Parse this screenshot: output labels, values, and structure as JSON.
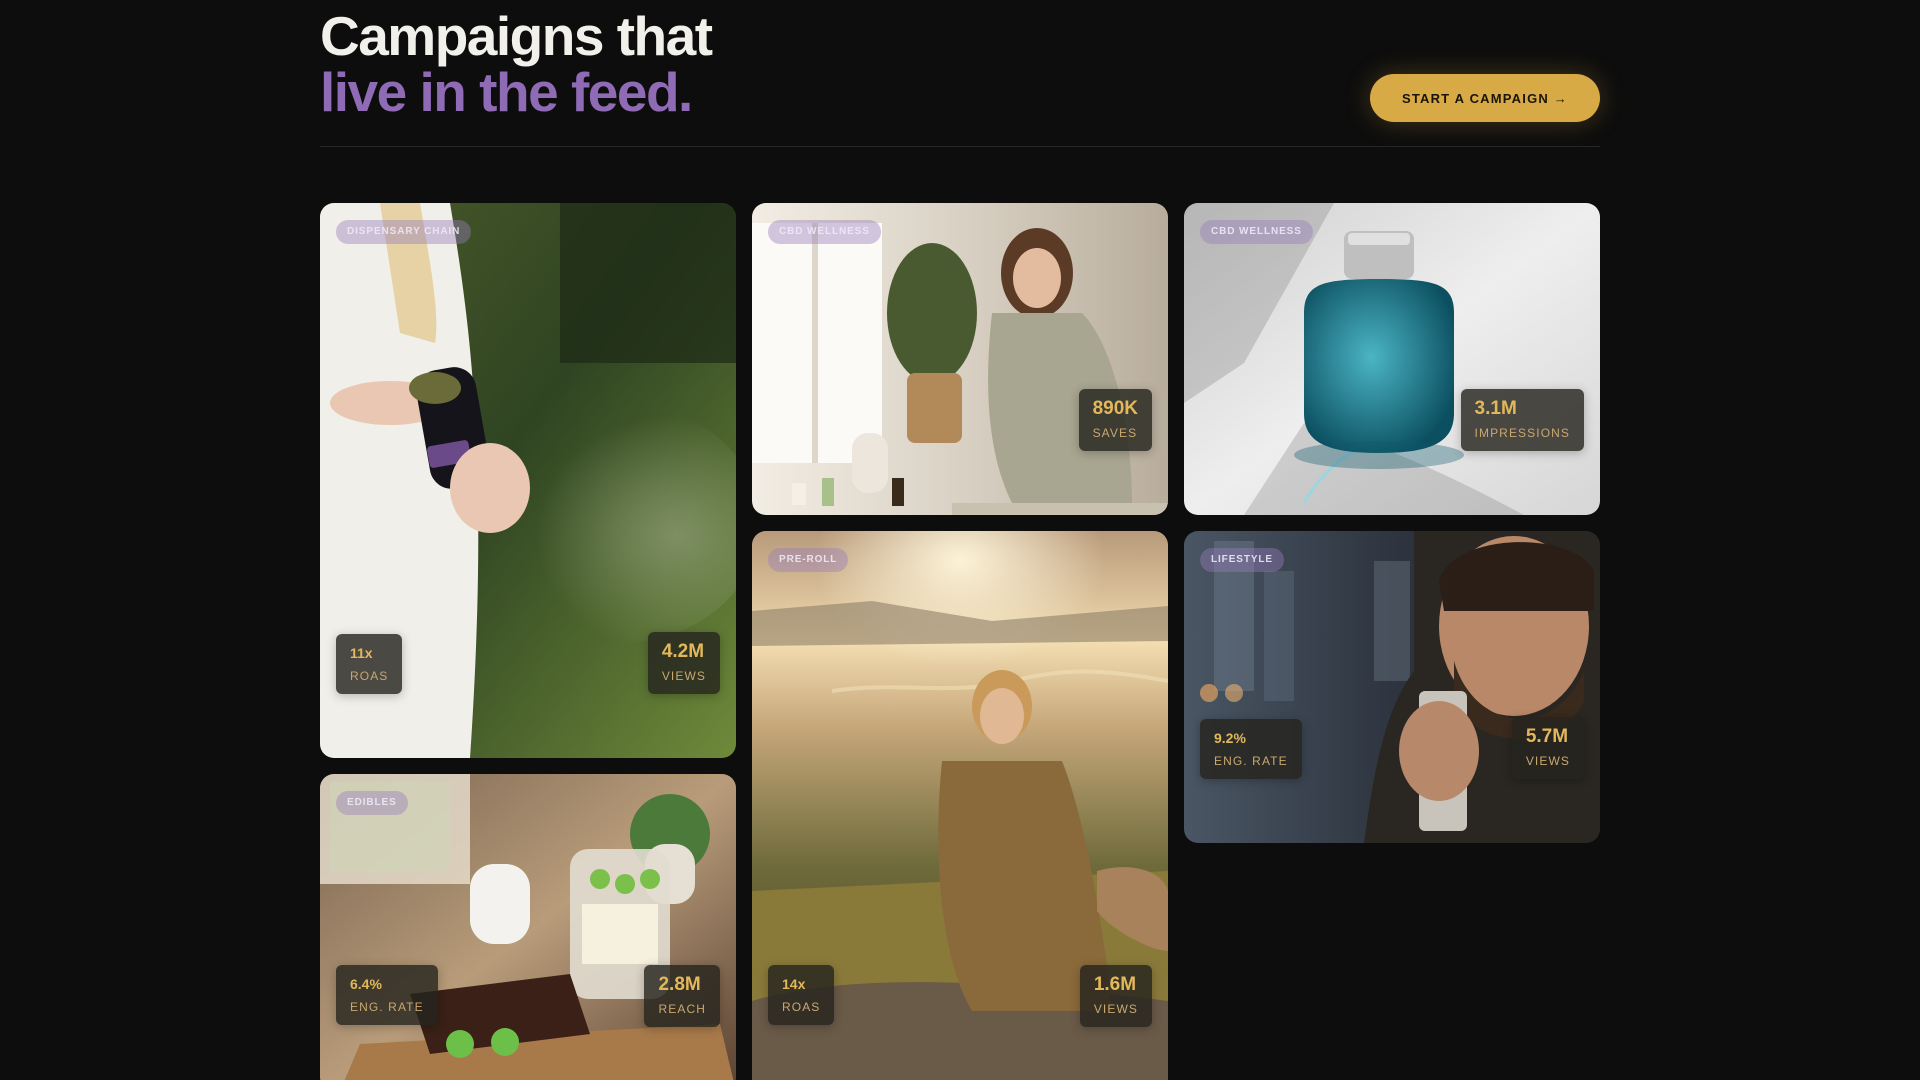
{
  "header": {
    "title_line1": "Campaigns that",
    "title_line2": "live in the feed.",
    "cta_label": "START A CAMPAIGN →"
  },
  "colors": {
    "background": "#0d0d0d",
    "title": "#f2f0ea",
    "accent_purple": "#8f6bb5",
    "accent_gold": "#d8aa45",
    "metric_value": "#e3b85a"
  },
  "cards": [
    {
      "tag": "DISPENSARY CHAIN",
      "image": "woman-holding-cannabis-jar",
      "stats": [
        {
          "value": "11x",
          "label": "ROAS"
        },
        {
          "value": "4.2M",
          "label": "VIEWS"
        }
      ]
    },
    {
      "tag": "CBD WELLNESS",
      "image": "woman-using-cbd-dropper",
      "stats": [
        {
          "value": "890K",
          "label": "SAVES"
        }
      ]
    },
    {
      "tag": "CBD WELLNESS",
      "image": "teal-glass-bottle",
      "stats": [
        {
          "value": "3.1M",
          "label": "IMPRESSIONS"
        }
      ]
    },
    {
      "tag": "PRE-ROLL",
      "image": "woman-smoking-in-meadow",
      "stats": [
        {
          "value": "14x",
          "label": "ROAS"
        },
        {
          "value": "1.6M",
          "label": "VIEWS"
        }
      ]
    },
    {
      "tag": "LIFESTYLE",
      "image": "man-with-vape",
      "stats": [
        {
          "value": "9.2%",
          "label": "ENG. RATE"
        },
        {
          "value": "5.7M",
          "label": "VIEWS"
        }
      ]
    },
    {
      "tag": "EDIBLES",
      "image": "edibles-on-kitchen-board",
      "stats": [
        {
          "value": "6.4%",
          "label": "ENG. RATE"
        },
        {
          "value": "2.8M",
          "label": "REACH"
        }
      ]
    }
  ]
}
